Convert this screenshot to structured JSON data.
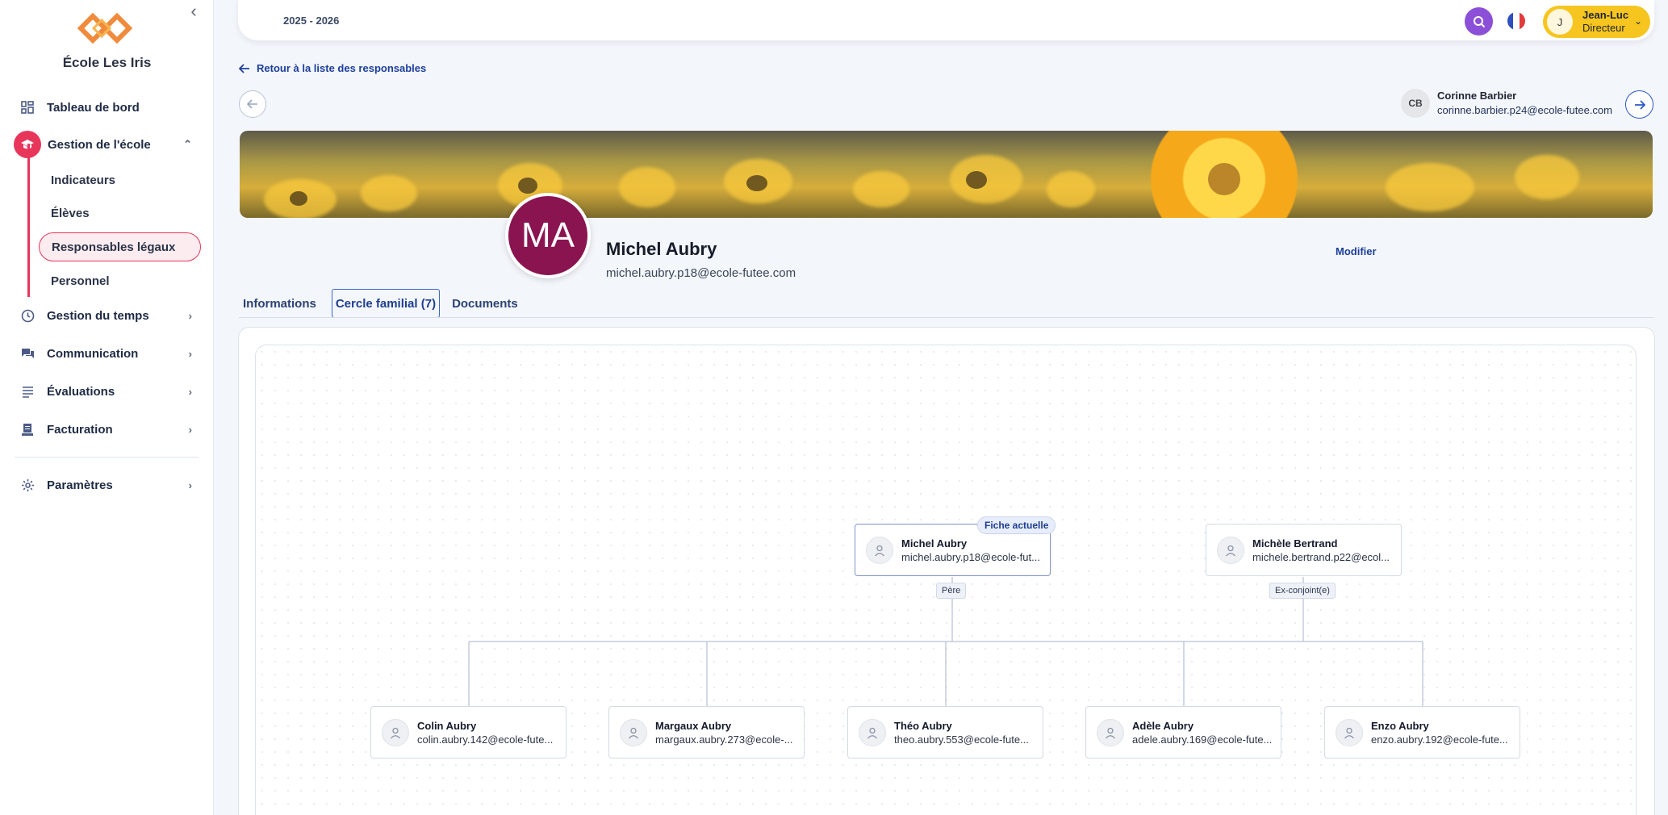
{
  "sidebar": {
    "school_name": "École Les Iris",
    "items": [
      {
        "label": "Tableau de bord",
        "icon": "dashboard-icon"
      },
      {
        "label": "Gestion de l'école",
        "icon": "graduation-cap-icon"
      },
      {
        "label": "Gestion du temps",
        "icon": "clock-icon"
      },
      {
        "label": "Communication",
        "icon": "chat-icon"
      },
      {
        "label": "Évaluations",
        "icon": "list-icon"
      },
      {
        "label": "Facturation",
        "icon": "invoice-icon"
      },
      {
        "label": "Paramètres",
        "icon": "gear-icon"
      }
    ],
    "sub_items": [
      {
        "label": "Indicateurs"
      },
      {
        "label": "Élèves"
      },
      {
        "label": "Responsables légaux"
      },
      {
        "label": "Personnel"
      }
    ],
    "accent": "#e8365b"
  },
  "topbar": {
    "year": "2025 - 2026",
    "user_initial": "J",
    "user_name": "Jean-Luc",
    "user_role": "Directeur"
  },
  "nav": {
    "back_label": "Retour à la liste des responsables",
    "next_initials": "CB",
    "next_name": "Corinne Barbier",
    "next_email": "corinne.barbier.p24@ecole-futee.com"
  },
  "profile": {
    "initials": "MA",
    "name": "Michel Aubry",
    "email": "michel.aubry.p18@ecole-futee.com",
    "edit_label": "Modifier",
    "avatar_color": "#8a1450"
  },
  "tabs": [
    {
      "label": "Informations"
    },
    {
      "label": "Cercle familial (7)"
    },
    {
      "label": "Documents"
    }
  ],
  "family": {
    "current_badge": "Fiche actuelle",
    "parents": [
      {
        "name": "Michel Aubry",
        "email": "michel.aubry.p18@ecole-fut...",
        "relation": "Père"
      },
      {
        "name": "Michèle Bertrand",
        "email": "michele.bertrand.p22@ecol...",
        "relation": "Ex-conjoint(e)"
      }
    ],
    "children": [
      {
        "name": "Colin Aubry",
        "email": "colin.aubry.142@ecole-fute..."
      },
      {
        "name": "Margaux Aubry",
        "email": "margaux.aubry.273@ecole-..."
      },
      {
        "name": "Théo Aubry",
        "email": "theo.aubry.553@ecole-fute..."
      },
      {
        "name": "Adèle Aubry",
        "email": "adele.aubry.169@ecole-fute..."
      },
      {
        "name": "Enzo Aubry",
        "email": "enzo.aubry.192@ecole-fute..."
      }
    ]
  }
}
